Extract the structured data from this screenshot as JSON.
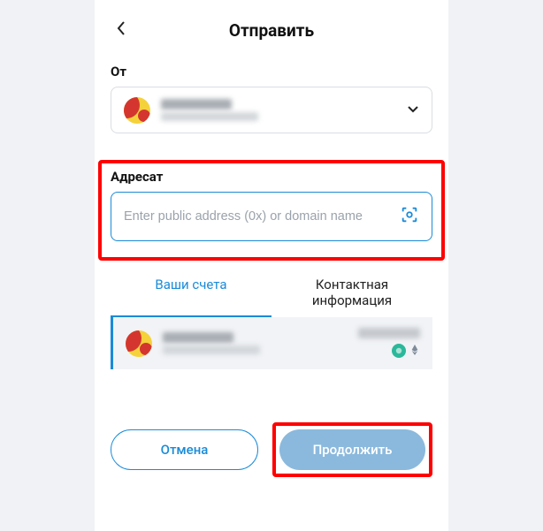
{
  "header": {
    "title": "Отправить"
  },
  "from": {
    "label": "От"
  },
  "recipient": {
    "label": "Адресат",
    "placeholder": "Enter public address (0x) or domain name"
  },
  "tabs": {
    "accounts": "Ваши счета",
    "contacts": "Контактная информация"
  },
  "footer": {
    "cancel": "Отмена",
    "continue": "Продолжить"
  }
}
